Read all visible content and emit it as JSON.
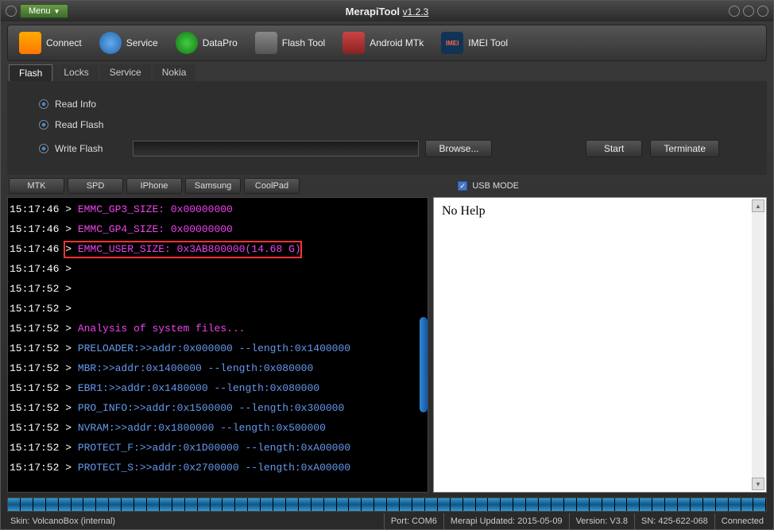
{
  "title": {
    "app": "MerapiTool",
    "version": "v1.2.3"
  },
  "menu": {
    "label": "Menu"
  },
  "toolbar": [
    {
      "label": "Connect"
    },
    {
      "label": "Service"
    },
    {
      "label": "DataPro"
    },
    {
      "label": "Flash Tool"
    },
    {
      "label": "Android MTk"
    },
    {
      "label": "IMEI Tool",
      "iconText": "IMEI"
    }
  ],
  "subtabs": [
    "Flash",
    "Locks",
    "Service",
    "Nokia"
  ],
  "options": {
    "read_info": "Read Info",
    "read_flash": "Read Flash",
    "write_flash": "Write Flash",
    "browse": "Browse...",
    "start": "Start",
    "terminate": "Terminate"
  },
  "device_tabs": [
    "MTK",
    "SPD",
    "IPhone",
    "Samsung",
    "CoolPad"
  ],
  "usb_mode": "USB MODE",
  "log": [
    {
      "ts": "15:17:46",
      "cls": "magenta",
      "text": "EMMC_GP3_SIZE: 0x00000000"
    },
    {
      "ts": "15:17:46",
      "cls": "magenta",
      "text": "EMMC_GP4_SIZE: 0x00000000"
    },
    {
      "ts": "15:17:46",
      "cls": "magenta",
      "text": "EMMC_USER_SIZE: 0x3AB800000(14.68 G)"
    },
    {
      "ts": "15:17:46",
      "cls": "",
      "text": ""
    },
    {
      "ts": "15:17:52",
      "cls": "",
      "text": ""
    },
    {
      "ts": "15:17:52",
      "cls": "",
      "text": ""
    },
    {
      "ts": "15:17:52",
      "cls": "magenta",
      "text": "Analysis of system files..."
    },
    {
      "ts": "15:17:52",
      "cls": "blue",
      "text": "PRELOADER:>>addr:0x000000 --length:0x1400000"
    },
    {
      "ts": "15:17:52",
      "cls": "blue",
      "text": "MBR:>>addr:0x1400000 --length:0x080000"
    },
    {
      "ts": "15:17:52",
      "cls": "blue",
      "text": "EBR1:>>addr:0x1480000 --length:0x080000"
    },
    {
      "ts": "15:17:52",
      "cls": "blue",
      "text": "PRO_INFO:>>addr:0x1500000 --length:0x300000"
    },
    {
      "ts": "15:17:52",
      "cls": "blue",
      "text": "NVRAM:>>addr:0x1800000 --length:0x500000"
    },
    {
      "ts": "15:17:52",
      "cls": "blue",
      "text": "PROTECT_F:>>addr:0x1D00000 --length:0xA00000"
    },
    {
      "ts": "15:17:52",
      "cls": "blue",
      "text": "PROTECT_S:>>addr:0x2700000 --length:0xA00000"
    }
  ],
  "help": {
    "text": "No Help"
  },
  "status": {
    "skin": "Skin: VolcanoBox (internal)",
    "port": "Port: COM6",
    "updated": "Merapi Updated: 2015-05-09",
    "version": "Version: V3.8",
    "sn": "SN: 425-622-068",
    "connected": "Connected"
  }
}
